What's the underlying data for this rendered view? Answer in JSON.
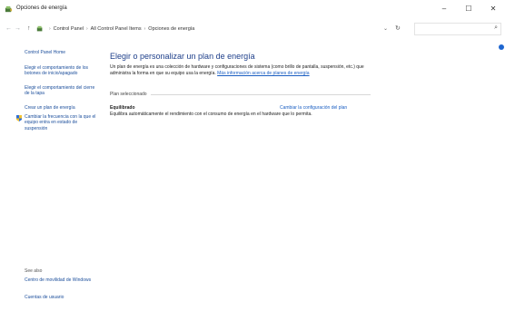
{
  "window": {
    "title": "Opciones de energía",
    "controls": {
      "minimize": "–",
      "maximize": "☐",
      "close": "✕"
    }
  },
  "address": {
    "crumbs": [
      "Control Panel",
      "All Control Panel Items",
      "Opciones de energía"
    ]
  },
  "sidebar": {
    "home": "Control Panel Home",
    "links": [
      "Elegir el comportamiento de los botones de inicio/apagado",
      "Elegir el comportamiento del cierre de la tapa",
      "Crear un plan de energía",
      "Cambiar la frecuencia con la que el equipo entra en estado de suspensión"
    ],
    "see_also_label": "See also",
    "see_also": [
      "Centro de movilidad de Windows",
      "Cuentas de usuario"
    ]
  },
  "main": {
    "heading": "Elegir o personalizar un plan de energía",
    "description": "Un plan de energía es una colección de hardware y configuraciones de sistema (como brillo de pantalla, suspensión, etc.) que administra la forma en que su equipo usa la energía.",
    "more_link": "Más información acerca de planes de energía",
    "section_label": "Plan seleccionado",
    "plan": {
      "name": "Equilibrado",
      "change_link": "Cambiar la configuración del plan",
      "description": "Equilibra automáticamente el rendimiento con el consumo de energía en el hardware que lo permita."
    }
  },
  "colors": {
    "link": "#1a4d9b",
    "heading": "#1e3f8a",
    "accent": "#1e66d0"
  }
}
